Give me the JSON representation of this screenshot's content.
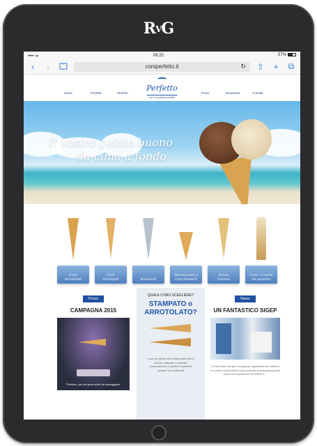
{
  "device": {
    "logo_main": "R",
    "logo_mid": "V",
    "logo_end": "G"
  },
  "status": {
    "carrier": "•••• ᯤ",
    "time": "09:25",
    "battery": "57%"
  },
  "browser": {
    "url": "coniperfetto.it",
    "back": "‹",
    "forward": "›",
    "reload": "↻",
    "share": "⇧",
    "add": "+",
    "tabs": "⧉"
  },
  "site": {
    "brand": "Perfetto",
    "tagline": "per il tuo gelato perfetto",
    "nav": [
      "Home",
      "Prodotti",
      "Perfetto",
      "Press",
      "Download",
      "Contatti"
    ]
  },
  "hero": {
    "line1": "Il vostro gelato buono",
    "line2": "da cima a fondo"
  },
  "products": [
    {
      "label1": "Coni",
      "label2": "Arrotolati"
    },
    {
      "label1": "Coni",
      "label2": "Stampati"
    },
    {
      "label1": "Ricoperti",
      "label2": ""
    },
    {
      "label1": "Decorazioni e",
      "label2": "Cup Dessert"
    },
    {
      "label1": "Senza",
      "label2": "Glutine"
    },
    {
      "label1": "Coni e Cialde",
      "label2": "da asporto"
    }
  ],
  "press": {
    "pill": "Press",
    "title": "CAMPAGNA 2015",
    "caption": "\"Perfetto, per chi ama cicchi da maneggiare\""
  },
  "choose": {
    "question": "QUALE CONO SCEGLIERE?",
    "line1": "STAMPATO o",
    "line2": "ARROTOLATO?",
    "text": "I coni per gelato sono essenzialmente di due tipi: stampati e arrotolati. Contrariamente a quanto si potrebbe pensare sono differenti"
  },
  "news": {
    "pill": "News",
    "title": "UN FANTASTICO SIGEP",
    "text": "La fiera sono sempre una grande opportunità per mettersi in mostra e quella della nostra azienda annunciando grandi primi con la presenza del settore e..."
  }
}
